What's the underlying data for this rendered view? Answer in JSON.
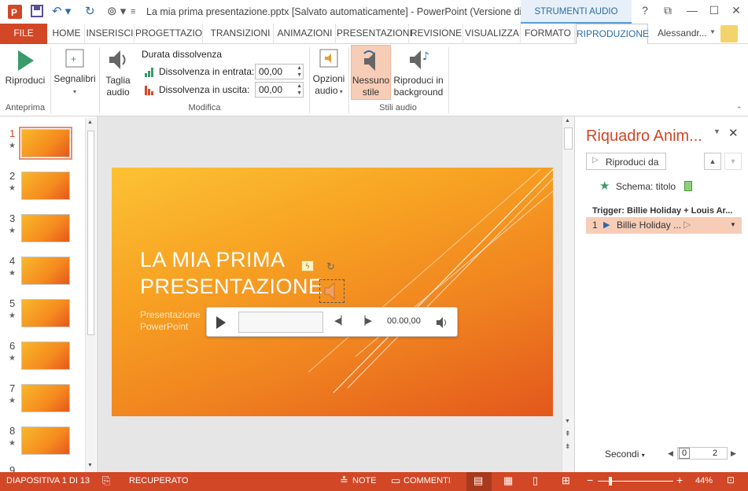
{
  "window": {
    "title": "La mia prima presentazione.pptx [Salvato automaticamente] - PowerPoint (Versione di...",
    "context_tab": "STRUMENTI AUDIO",
    "user": "Alessandr..."
  },
  "tabs": [
    "FILE",
    "HOME",
    "INSERISCI",
    "PROGETTAZIO",
    "TRANSIZIONI",
    "ANIMAZIONI",
    "PRESENTAZIONI",
    "REVISIONE",
    "VISUALIZZA",
    "FORMATO",
    "RIPRODUZIONE"
  ],
  "active_tab": "RIPRODUZIONE",
  "ribbon": {
    "play": "Riproduci",
    "group_preview": "Anteprima",
    "bookmarks": "Segnalibri",
    "trim_line1": "Taglia",
    "trim_line2": "audio",
    "fade_duration": "Durata dissolvenza",
    "fade_in_label": "Dissolvenza in entrata:",
    "fade_in_value": "00,00",
    "fade_out_label": "Dissolvenza in uscita:",
    "fade_out_value": "00,00",
    "group_edit": "Modifica",
    "audio_options_line1": "Opzioni",
    "audio_options_line2": "audio",
    "no_style_line1": "Nessuno",
    "no_style_line2": "stile",
    "play_bg_line1": "Riproduci in",
    "play_bg_line2": "background",
    "group_audio_styles": "Stili audio"
  },
  "thumbnails": [
    "1",
    "2",
    "3",
    "4",
    "5",
    "6",
    "7",
    "8",
    "9"
  ],
  "slide": {
    "title": "LA MIA PRIMA\nPRESENTAZIONE",
    "subtitle": "Presentazione\nPowerPoint"
  },
  "media": {
    "time": "00.00,00"
  },
  "animation_pane": {
    "title": "Riquadro Anim...",
    "play_from": "Riproduci da",
    "scheme": "Schema: titolo",
    "trigger": "Trigger: Billie Holiday + Louis Ar...",
    "item_number": "1",
    "item_label": "Billie Holiday ...",
    "seconds": "Secondi",
    "timeline_start": "0",
    "timeline_end": "2"
  },
  "status": {
    "slide": "DIAPOSITIVA 1 DI 13",
    "recovered": "RECUPERATO",
    "notes": "NOTE",
    "comments": "COMMENTI",
    "zoom": "44%"
  },
  "colors": {
    "accent": "#d24726",
    "slide_top": "#fcc234",
    "slide_bottom": "#e3571c"
  }
}
